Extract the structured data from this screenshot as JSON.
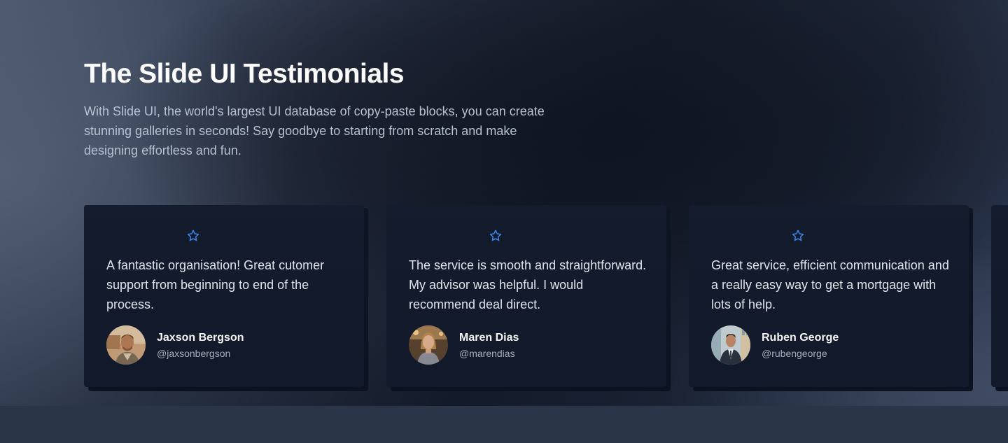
{
  "section": {
    "title": "The Slide UI Testimonials",
    "description": "With Slide UI, the world's largest UI database of copy-paste blocks, you can create stunning galleries in seconds! Say goodbye to starting from scratch and make designing effortless and fun."
  },
  "testimonials": [
    {
      "quote": "A fantastic organisation! Great cutomer support from beginning to end of the process.",
      "name": "Jaxson Bergson",
      "handle": "@jaxsonbergson",
      "rating_icon": "star-outline-icon"
    },
    {
      "quote": "The service is smooth and straightforward. My advisor was helpful. I would recommend deal direct.",
      "name": "Maren Dias",
      "handle": "@marendias",
      "rating_icon": "star-outline-icon"
    },
    {
      "quote": "Great service, efficient communication and a really easy way to get a mortgage with lots of help.",
      "name": "Ruben George",
      "handle": "@rubengeorge",
      "rating_icon": "star-outline-icon"
    }
  ],
  "colors": {
    "accent": "#3b8cf0",
    "card_background": "#121a2c",
    "title": "#ffffff",
    "body_text": "#b9c3d3"
  }
}
